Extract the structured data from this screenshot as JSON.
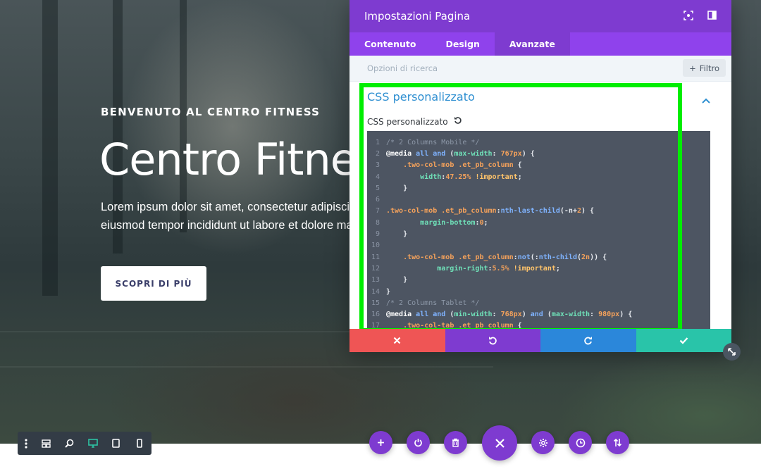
{
  "hero": {
    "subtitle": "BENVENUTO AL CENTRO FITNESS",
    "title": "Centro Fitness",
    "text_line1": "Lorem ipsum dolor sit amet, consectetur adipiscing elit, sed do",
    "text_line2": "eiusmod tempor incididunt ut labore et dolore magna aliqua.",
    "button_label": "SCOPRI DI PIÙ"
  },
  "modal": {
    "title": "Impostazioni Pagina",
    "tabs": [
      {
        "label": "Contenuto",
        "active": false
      },
      {
        "label": "Design",
        "active": false
      },
      {
        "label": "Avanzate",
        "active": true
      }
    ],
    "search_placeholder": "Opzioni di ricerca",
    "filter_label": "Filtro",
    "section_title": "CSS personalizzato",
    "field_label": "CSS personalizzato",
    "code_lines": [
      {
        "n": "1",
        "text": "/* 2 Columns Mobile */"
      },
      {
        "n": "2",
        "text": "@media all and (max-width: 767px) {"
      },
      {
        "n": "3",
        "text": "    .two-col-mob .et_pb_column {"
      },
      {
        "n": "4",
        "text": "        width:47.25% !important;"
      },
      {
        "n": "5",
        "text": "    }"
      },
      {
        "n": "6",
        "text": ""
      },
      {
        "n": "7",
        "text": ".two-col-mob .et_pb_column:nth-last-child(-n+2) {"
      },
      {
        "n": "8",
        "text": "        margin-bottom:0;"
      },
      {
        "n": "9",
        "text": "    }"
      },
      {
        "n": "10",
        "text": ""
      },
      {
        "n": "11",
        "text": "    .two-col-mob .et_pb_column:not(:nth-child(2n)) {"
      },
      {
        "n": "12",
        "text": "            margin-right:5.5% !important;"
      },
      {
        "n": "13",
        "text": "    }"
      },
      {
        "n": "14",
        "text": "}"
      },
      {
        "n": "15",
        "text": "/* 2 Columns Tablet */"
      },
      {
        "n": "16",
        "text": "@media all and (min-width: 768px) and (max-width: 980px) {"
      },
      {
        "n": "17",
        "text": "    .two-col-tab .et_pb_column {"
      }
    ]
  },
  "colors": {
    "purple_dark": "#7e3bd0",
    "purple_tab": "#8f42ec",
    "cancel_red": "#ef5555",
    "redo_blue": "#2b87da",
    "save_teal": "#29c4a9",
    "highlight_green": "#00ee00",
    "editor_bg": "#4d5562"
  },
  "icons": {
    "header": [
      "target-icon",
      "sidebar-toggle-icon"
    ],
    "actions": [
      "close-icon",
      "undo-icon",
      "redo-icon",
      "check-icon"
    ],
    "view_toolbar": [
      "menu-dots-icon",
      "wireframe-icon",
      "zoom-icon",
      "desktop-icon",
      "tablet-icon",
      "phone-icon"
    ],
    "fabs": [
      "add-icon",
      "power-icon",
      "trash-icon",
      "close-icon",
      "gear-icon",
      "history-icon",
      "sort-icon"
    ]
  }
}
